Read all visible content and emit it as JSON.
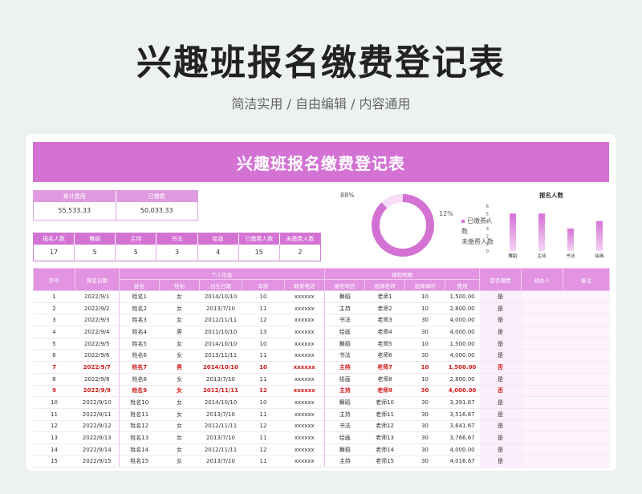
{
  "page": {
    "title": "兴趣班报名缴费登记表",
    "subtitle": "简洁实用 / 自由编辑 / 内容通用"
  },
  "sheet": {
    "title": "兴趣班报名缴费登记表",
    "summary": {
      "total_label": "累计费用",
      "paid_label": "已缴费",
      "total_value": "55,533.33",
      "paid_value": "50,033.33"
    },
    "counts": {
      "headers": [
        "报名人数",
        "舞蹈",
        "主持",
        "书法",
        "绘画",
        "已缴费人数",
        "未缴费人数"
      ],
      "values": [
        "17",
        "5",
        "5",
        "3",
        "4",
        "15",
        "2"
      ]
    },
    "donut": {
      "paid_pct_label": "88%",
      "unpaid_pct_label": "12%",
      "legend_paid": "已缴费人数",
      "legend_unpaid": "未缴费人数",
      "paid_fraction": 0.88,
      "colors": {
        "paid": "#d472d4",
        "unpaid": "#f6dcf6"
      }
    },
    "table": {
      "group_personal": "个人信息",
      "group_course": "课程明细",
      "headers": {
        "seq": "序号",
        "date": "报名日期",
        "name": "姓名",
        "gender": "性别",
        "birth": "出生日期",
        "age": "年龄",
        "phone": "联系电话",
        "course": "报名项目",
        "teacher": "授课老师",
        "lessons": "选择课时",
        "fee": "费用",
        "paid": "是否缴费",
        "handler": "经办人",
        "remark": "备注"
      },
      "rows": [
        [
          "1",
          "2022/9/1",
          "姓名1",
          "女",
          "2014/10/10",
          "10",
          "xxxxxx",
          "舞蹈",
          "老师1",
          "10",
          "1,500.00",
          "是"
        ],
        [
          "2",
          "2022/9/2",
          "姓名2",
          "女",
          "2013/7/10",
          "11",
          "xxxxxx",
          "主持",
          "老师2",
          "10",
          "2,800.00",
          "是"
        ],
        [
          "3",
          "2022/9/3",
          "姓名3",
          "女",
          "2012/11/11",
          "12",
          "xxxxxx",
          "书法",
          "老师3",
          "30",
          "4,000.00",
          "是"
        ],
        [
          "4",
          "2022/9/4",
          "姓名4",
          "男",
          "2011/10/10",
          "13",
          "xxxxxx",
          "绘画",
          "老师4",
          "30",
          "4,000.00",
          "是"
        ],
        [
          "5",
          "2022/9/5",
          "姓名5",
          "女",
          "2014/10/10",
          "10",
          "xxxxxx",
          "舞蹈",
          "老师5",
          "10",
          "1,500.00",
          "是"
        ],
        [
          "6",
          "2022/9/6",
          "姓名6",
          "女",
          "2013/11/11",
          "11",
          "xxxxxx",
          "书法",
          "老师6",
          "30",
          "4,000.00",
          "是"
        ],
        [
          "7",
          "2022/9/7",
          "姓名7",
          "男",
          "2014/10/10",
          "10",
          "xxxxxx",
          "主持",
          "老师7",
          "10",
          "1,500.00",
          "否"
        ],
        [
          "8",
          "2022/9/8",
          "姓名8",
          "女",
          "2013/7/10",
          "11",
          "xxxxxx",
          "绘画",
          "老师8",
          "10",
          "2,800.00",
          "是"
        ],
        [
          "9",
          "2022/9/9",
          "姓名9",
          "女",
          "2012/11/11",
          "12",
          "xxxxxx",
          "主持",
          "老师9",
          "30",
          "4,000.00",
          "否"
        ],
        [
          "10",
          "2022/9/10",
          "姓名10",
          "女",
          "2014/10/10",
          "10",
          "xxxxxx",
          "舞蹈",
          "老师10",
          "30",
          "3,391.67",
          "是"
        ],
        [
          "11",
          "2022/9/11",
          "姓名11",
          "女",
          "2013/7/10",
          "11",
          "xxxxxx",
          "主持",
          "老师11",
          "30",
          "3,516.67",
          "是"
        ],
        [
          "12",
          "2022/9/12",
          "姓名12",
          "女",
          "2012/11/11",
          "12",
          "xxxxxx",
          "书法",
          "老师12",
          "30",
          "3,641.67",
          "是"
        ],
        [
          "13",
          "2022/9/13",
          "姓名13",
          "女",
          "2013/7/10",
          "11",
          "xxxxxx",
          "绘画",
          "老师13",
          "30",
          "3,766.67",
          "是"
        ],
        [
          "14",
          "2022/9/14",
          "姓名14",
          "女",
          "2012/11/11",
          "12",
          "xxxxxx",
          "舞蹈",
          "老师14",
          "30",
          "4,000.00",
          "是"
        ],
        [
          "15",
          "2022/9/15",
          "姓名15",
          "女",
          "2013/7/10",
          "11",
          "xxxxxx",
          "主持",
          "老师15",
          "30",
          "4,016.67",
          "是"
        ]
      ],
      "highlight_color": "#d01818"
    }
  },
  "chart_data": {
    "type": "bar",
    "title": "报名人数",
    "categories": [
      "舞蹈",
      "主持",
      "书法",
      "绘画"
    ],
    "values": [
      5,
      5,
      3,
      4
    ],
    "yticks": [
      "0",
      "1",
      "2",
      "3",
      "4",
      "5",
      "6"
    ],
    "ylim": [
      0,
      6
    ],
    "color": "#d472d4"
  }
}
